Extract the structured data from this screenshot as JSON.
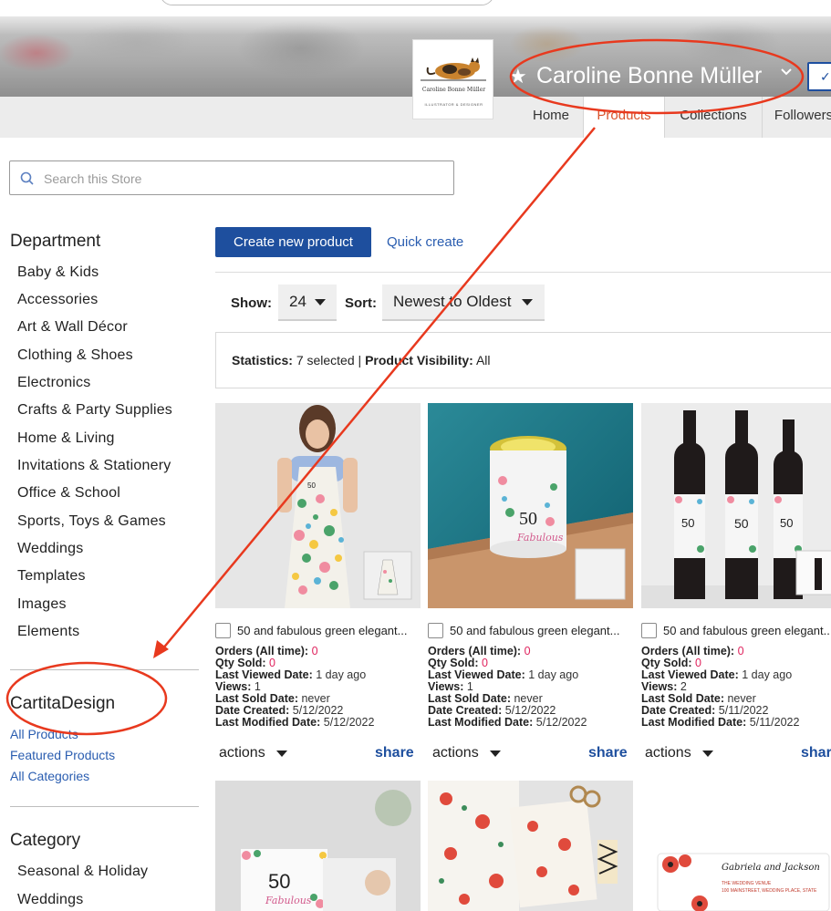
{
  "header": {
    "store_name": "Caroline Bonne Müller",
    "logo_line1": "Caroline Bonne Müller",
    "logo_line2": "ILLUSTRATOR & DESIGNER",
    "follow_symbol": "✓"
  },
  "nav": {
    "tabs": [
      {
        "label": "Home"
      },
      {
        "label": "Products"
      },
      {
        "label": "Collections"
      },
      {
        "label": "Followers"
      }
    ],
    "active_tab": "Products"
  },
  "search": {
    "placeholder": "Search this Store"
  },
  "sidebar": {
    "department_heading": "Department",
    "departments": [
      "Baby & Kids",
      "Accessories",
      "Art & Wall Décor",
      "Clothing & Shoes",
      "Electronics",
      "Crafts & Party Supplies",
      "Home & Living",
      "Invitations & Stationery",
      "Office & School",
      "Sports, Toys & Games",
      "Weddings",
      "Templates",
      "Images",
      "Elements"
    ],
    "store_heading": "CartitaDesign",
    "store_links": [
      "All Products",
      "Featured Products",
      "All Categories"
    ],
    "category_heading": "Category",
    "categories": [
      "Seasonal & Holiday",
      "Weddings"
    ]
  },
  "toolbar": {
    "create_label": "Create new product",
    "quick_label": "Quick create",
    "show_label": "Show:",
    "show_value": "24",
    "sort_label": "Sort:",
    "sort_value": "Newest to Oldest"
  },
  "stats": {
    "statistics_label": "Statistics:",
    "statistics_value": "7 selected |",
    "visibility_label": "Product Visibility:",
    "visibility_value": "All"
  },
  "products": [
    {
      "title": "50 and fabulous green elegant...",
      "orders": "0",
      "qty": "0",
      "last_viewed": "1 day ago",
      "views": "1",
      "last_sold": "never",
      "created": "5/12/2022",
      "modified": "5/12/2022"
    },
    {
      "title": "50 and fabulous green elegant...",
      "orders": "0",
      "qty": "0",
      "last_viewed": "1 day ago",
      "views": "1",
      "last_sold": "never",
      "created": "5/12/2022",
      "modified": "5/12/2022"
    },
    {
      "title": "50 and fabulous green elegant...",
      "orders": "0",
      "qty": "0",
      "last_viewed": "1 day ago",
      "views": "2",
      "last_sold": "never",
      "created": "5/11/2022",
      "modified": "5/11/2022"
    }
  ],
  "meta_labels": {
    "orders": "Orders (All time):",
    "qty": "Qty Sold:",
    "last_viewed": "Last Viewed Date:",
    "views": "Views:",
    "last_sold": "Last Sold Date:",
    "created": "Date Created:",
    "modified": "Last Modified Date:"
  },
  "card_actions": {
    "actions_label": "actions",
    "share_label": "share"
  },
  "thumbnail_text": {
    "num": "50",
    "word": "Fabulous",
    "wedding_names": "Gabriela and Jackson",
    "wedding_venue": "THE WEDDING VENUE",
    "wedding_address": "100 MAINSTREET, WEDDING PLACE, STATE"
  },
  "colors": {
    "accent": "#1e4f9e",
    "active_tab": "#d9532c",
    "annotation": "#e8391e",
    "count": "#e0245e"
  }
}
